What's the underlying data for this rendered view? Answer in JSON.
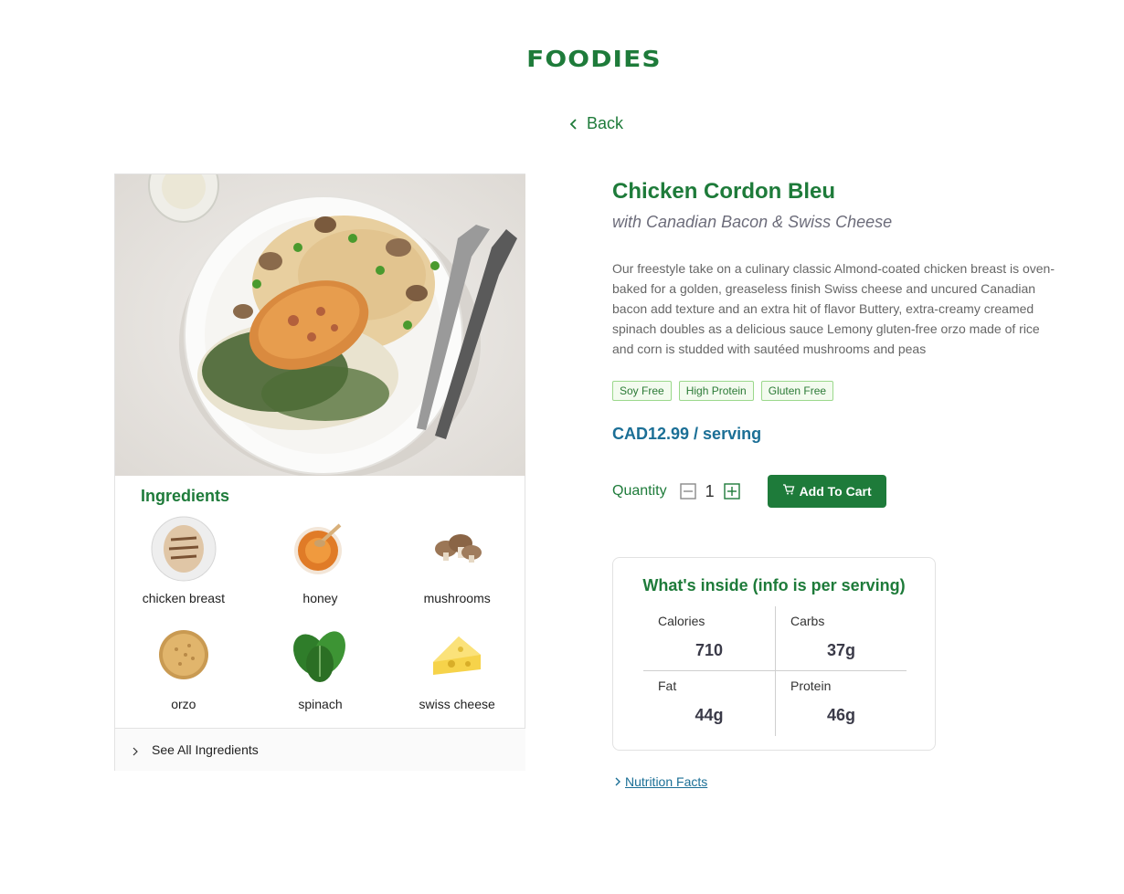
{
  "brand": {
    "logo_text": "FOODIES",
    "color": "#1e7b3a"
  },
  "nav": {
    "back_label": "Back"
  },
  "product": {
    "title": "Chicken Cordon Bleu",
    "subtitle": "with Canadian Bacon & Swiss Cheese",
    "description": "Our freestyle take on a culinary classic Almond-coated chicken breast is oven-baked for a golden, greaseless finish Swiss cheese and uncured Canadian bacon add texture and an extra hit of flavor Buttery, extra-creamy creamed spinach doubles as a delicious sauce Lemony gluten-free orzo made of rice and corn is studded with sautéed mushrooms and peas",
    "tags": [
      "Soy Free",
      "High Protein",
      "Gluten Free"
    ],
    "price": "CAD12.99 / serving",
    "quantity_label": "Quantity",
    "quantity": "1",
    "add_to_cart_label": "Add To Cart"
  },
  "ingredients": {
    "title": "Ingredients",
    "items": [
      {
        "label": "chicken breast",
        "icon": "chicken-breast"
      },
      {
        "label": "honey",
        "icon": "honey"
      },
      {
        "label": "mushrooms",
        "icon": "mushrooms"
      },
      {
        "label": "orzo",
        "icon": "orzo"
      },
      {
        "label": "spinach",
        "icon": "spinach"
      },
      {
        "label": "swiss cheese",
        "icon": "swiss-cheese"
      }
    ],
    "see_all_label": "See All Ingredients"
  },
  "nutrition": {
    "title": "What's inside (info is per serving)",
    "calories_label": "Calories",
    "calories": "710",
    "carbs_label": "Carbs",
    "carbs": "37g",
    "fat_label": "Fat",
    "fat": "44g",
    "protein_label": "Protein",
    "protein": "46g",
    "facts_link": "Nutrition Facts"
  },
  "colors": {
    "accent_green": "#1e7b3a",
    "price_blue": "#1b6f96",
    "tag_border": "#9bd88c",
    "tag_bg": "#f3fbef"
  }
}
